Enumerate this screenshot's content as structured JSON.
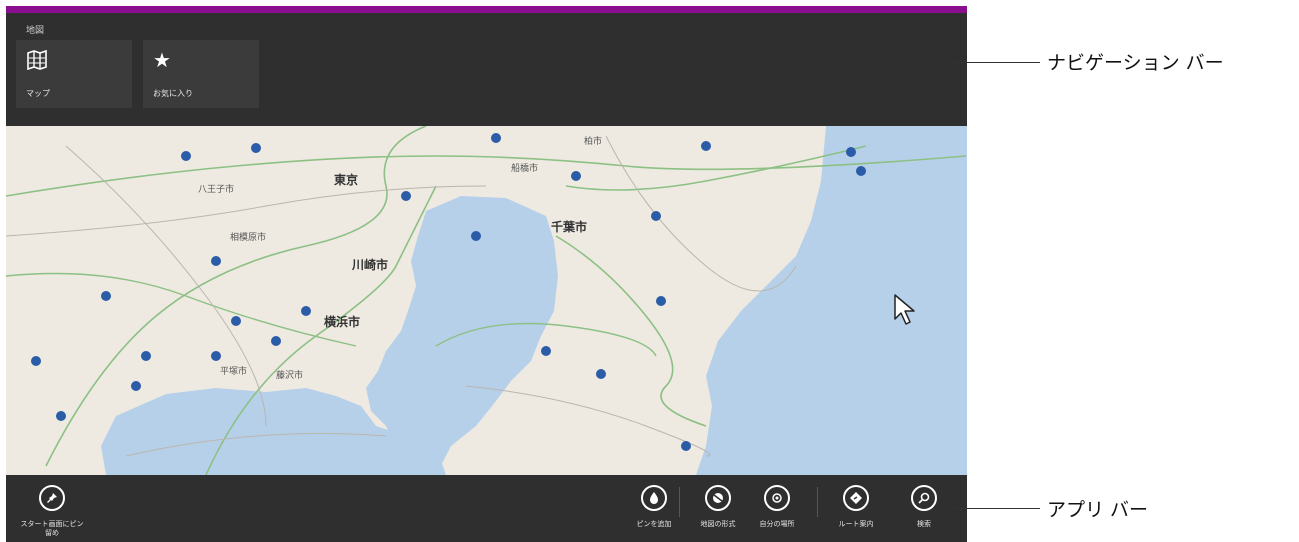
{
  "colors": {
    "accent": "#8a0f8f",
    "bars": "#2f2f2f",
    "tile": "#3b3b3b",
    "water": "#b7d0ea",
    "land": "#eeeae1"
  },
  "navbar": {
    "title": "地図",
    "tiles": [
      {
        "label": "マップ",
        "icon": "map-icon"
      },
      {
        "label": "お気に入り",
        "icon": "star-icon"
      }
    ]
  },
  "map": {
    "cities": {
      "tokyo": "東京",
      "chiba": "千葉市",
      "kawasaki": "川崎市",
      "yokohama": "横浜市",
      "sagamihara": "相模原市",
      "funabashi": "船橋市",
      "hachioji": "八王子市",
      "hiratsuka": "平塚市",
      "fujisawa": "藤沢市",
      "kashiwa": "柏市"
    }
  },
  "appbar": {
    "left": {
      "label_line1": "スタート画面にピン",
      "label_line2": "留め",
      "icon": "pin-icon"
    },
    "right": [
      {
        "label": "ピンを追加",
        "icon": "drop-pin-icon"
      },
      {
        "label": "地図の形式",
        "icon": "map-style-icon"
      },
      {
        "label": "自分の場所",
        "icon": "location-icon"
      },
      {
        "label": "ルート案内",
        "icon": "directions-icon"
      },
      {
        "label": "検索",
        "icon": "search-icon"
      }
    ]
  },
  "callouts": {
    "navbar": "ナビゲーション バー",
    "appbar": "アプリ バー"
  }
}
